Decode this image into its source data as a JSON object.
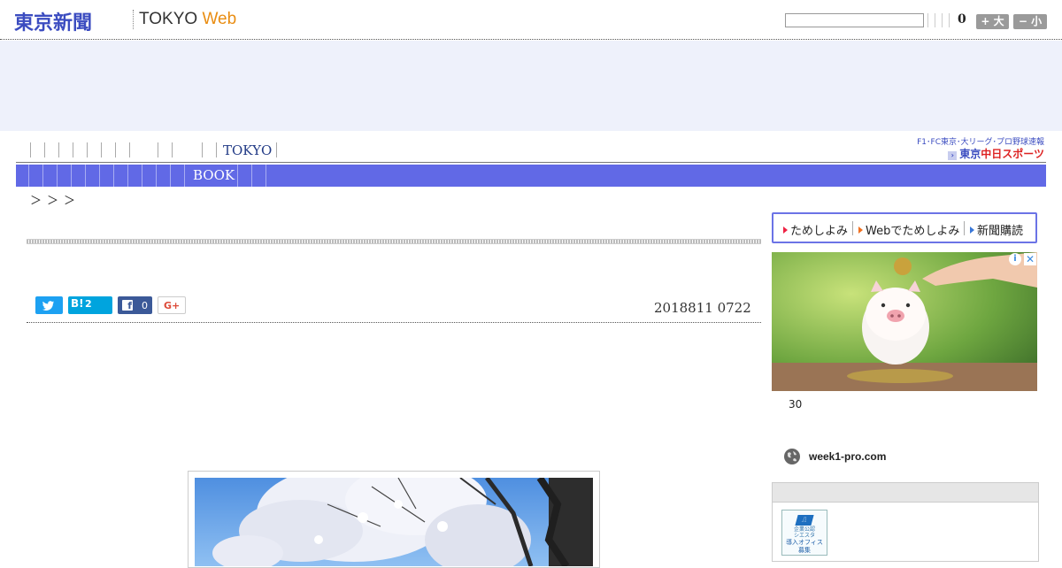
{
  "header": {
    "logo_jp": "東京新聞",
    "logo_en": "TOKYO",
    "logo_web": "Web",
    "search_placeholder": "",
    "count": "0",
    "font_larger": "+ 大",
    "font_smaller": "− 小"
  },
  "nav_primary": {
    "highlight_label": "TOKYO"
  },
  "sponsor": {
    "line1": "F1･FC東京･大リーグ･プロ野球速報",
    "line2_prefix": "東京",
    "line2_brand": "中日スポーツ"
  },
  "nav_secondary": {
    "highlight_label": "BOOK"
  },
  "breadcrumb": "＞＞＞",
  "article": {
    "date": "2018811 0722",
    "share": {
      "hatena_label": "B!",
      "hatena_count": "2",
      "facebook_count": "0",
      "gplus_label": "G+"
    }
  },
  "sidebar": {
    "tame": {
      "item1": "ためしよみ",
      "item2": "Webでためしよみ",
      "item3": "新聞購読"
    },
    "ad": {
      "info": "i",
      "close": "✕",
      "text": "30",
      "domain": "week1-pro.com"
    },
    "banner": {
      "line1": "企業公認",
      "line2": "シエスタ",
      "line3": "導入オフィス",
      "line4": "募集"
    }
  },
  "colors": {
    "brand_blue": "#3b4cc0",
    "nav_blue": "#6169e6",
    "ad_band": "#eef1fb",
    "web_orange": "#e98d12"
  }
}
